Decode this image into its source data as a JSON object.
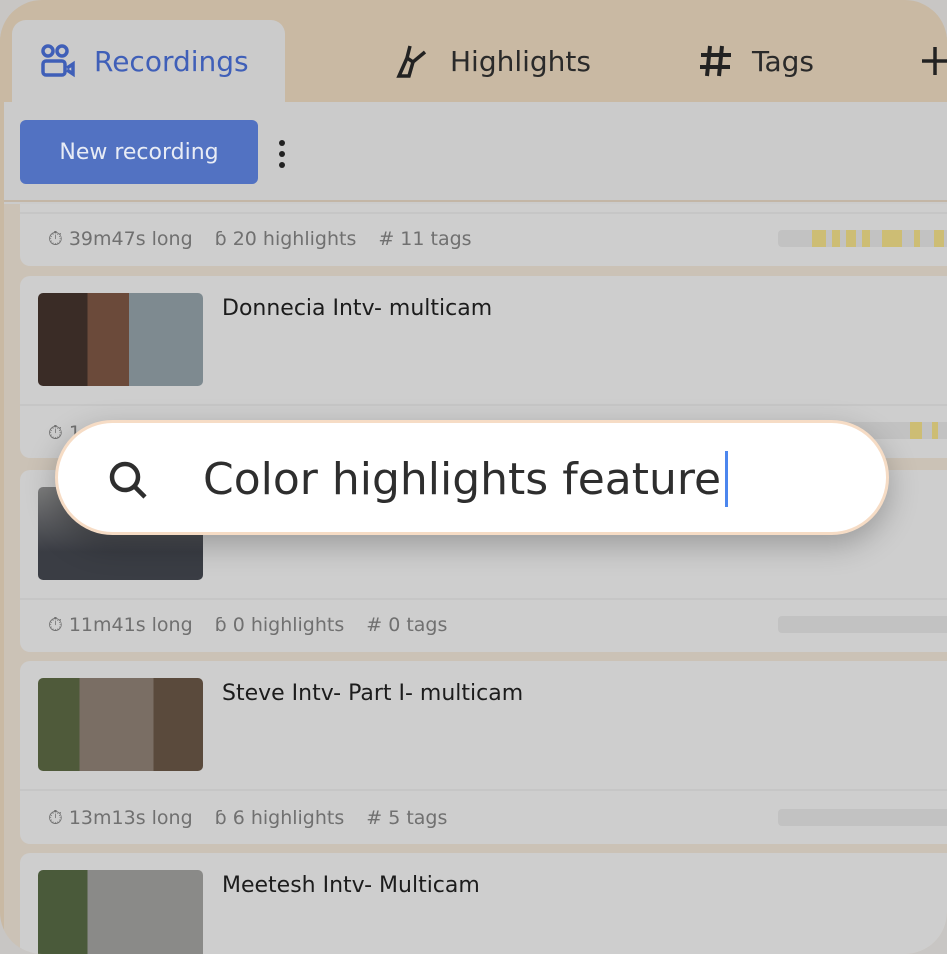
{
  "tabs": [
    {
      "label": "Recordings",
      "icon": "recordings-icon",
      "active": true
    },
    {
      "label": "Highlights",
      "icon": "highlighter-icon"
    },
    {
      "label": "Tags",
      "icon": "hash-icon"
    }
  ],
  "toolbar": {
    "new_recording_label": "New recording"
  },
  "recordings": [
    {
      "title": "",
      "duration": "39m47s long",
      "highlights": "20 highlights",
      "tags": "11 tags"
    },
    {
      "title": "Donnecia Intv- multicam",
      "duration": "1",
      "highlights": "",
      "tags": ""
    },
    {
      "title": "",
      "duration": "11m41s long",
      "highlights": "0 highlights",
      "tags": "0 tags"
    },
    {
      "title": "Steve Intv- Part I- multicam",
      "duration": "13m13s long",
      "highlights": "6 highlights",
      "tags": "5 tags"
    },
    {
      "title": "Meetesh Intv- Multicam",
      "duration": "",
      "highlights": "",
      "tags": ""
    }
  ],
  "search": {
    "value": "Color highlights feature"
  },
  "colors": {
    "accent": "#5272c2",
    "highlight": "#cdbd74",
    "tab_bar": "#c9b9a3"
  }
}
